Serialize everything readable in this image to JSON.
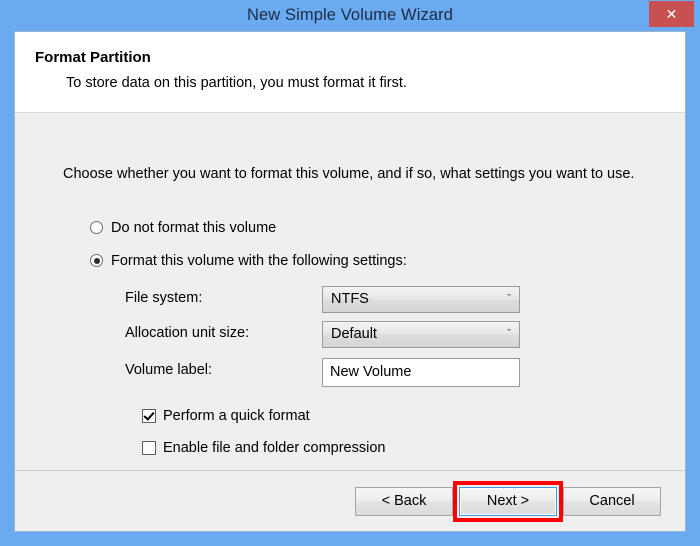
{
  "window": {
    "title": "New Simple Volume Wizard",
    "close_label": "✕",
    "titlebar_color": "#6aaaf0",
    "close_button_color": "#c75050"
  },
  "header": {
    "title": "Format Partition",
    "subtitle": "To store data on this partition, you must format it first."
  },
  "body": {
    "intro": "Choose whether you want to format this volume, and if so, what settings you want to use.",
    "radios": [
      {
        "label": "Do not format this volume",
        "checked": false
      },
      {
        "label": "Format this volume with the following settings:",
        "checked": true
      }
    ],
    "fields": [
      {
        "label": "File system:",
        "value": "NTFS",
        "type": "dropdown"
      },
      {
        "label": "Allocation unit size:",
        "value": "Default",
        "type": "dropdown"
      },
      {
        "label": "Volume label:",
        "value": "New Volume",
        "type": "textbox"
      }
    ],
    "chevron": "ˇ",
    "checkboxes": [
      {
        "label": "Perform a quick format",
        "checked": true
      },
      {
        "label": "Enable file and folder compression",
        "checked": false
      }
    ]
  },
  "footer": {
    "back_label": "< Back",
    "next_label": "Next >",
    "cancel_label": "Cancel"
  },
  "annotation": {
    "color": "#ff0000",
    "target": "Next >"
  }
}
